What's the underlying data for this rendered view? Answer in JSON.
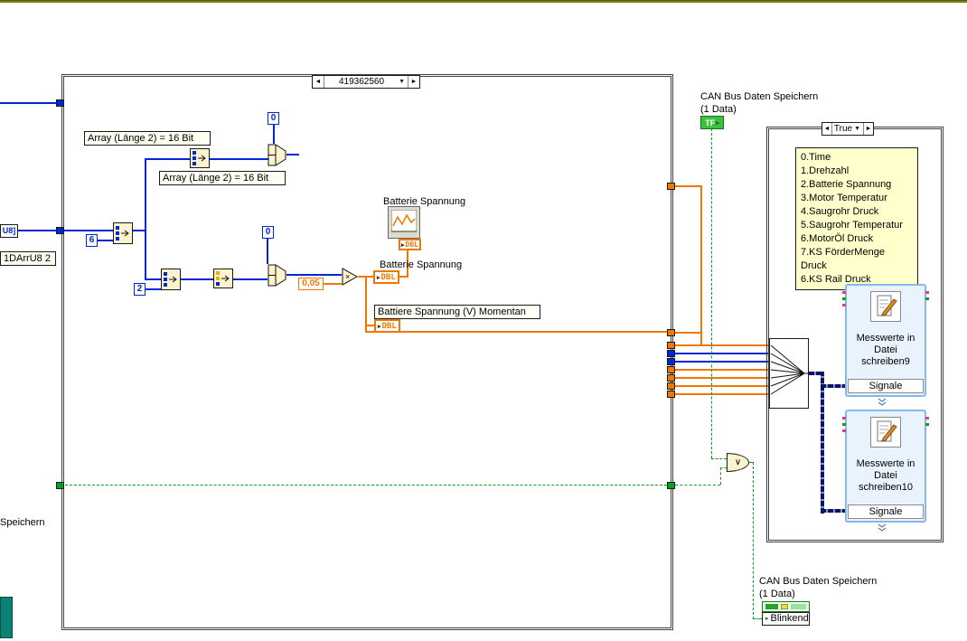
{
  "icons": {
    "arrow_left": "◄",
    "arrow_right": "►",
    "dropdown": "▼",
    "terminal_arrow": "▸",
    "or_symbol": "∨",
    "multiply_symbol": "×"
  },
  "dbl_label": "DBL",
  "header": {
    "can_label_line1": "CAN Bus Daten Speichern",
    "can_label_line2": "(1 Data)",
    "tf_label": "TF"
  },
  "left_edge": {
    "u8_constant": "U8]",
    "array_label": "1DArrU8 2",
    "speichern_label": "Speichern"
  },
  "main_case": {
    "selector": "419362560",
    "label_array16_1": "Array (Länge 2) = 16 Bit",
    "label_array16_2": "Array (Länge 2) = 16 Bit",
    "const_zero_1": "0",
    "const_zero_2": "0",
    "const_six": "6",
    "const_two": "2",
    "const_factor": "0,05",
    "label_chart": "Batterie Spannung",
    "label_dbl": "Batterie Spannung",
    "label_momentan": "Battiere Spannung (V) Momentan"
  },
  "right_case": {
    "selector": "True",
    "signals": [
      "0.Time",
      "1.Drehzahl",
      "2.Batterie Spannung",
      "3.Motor Temperatur",
      "4.Saugrohr Druck",
      "5.Saugrohr Temperatur",
      "6.MotorÖl Druck",
      "7.KS FörderMenge Druck",
      "6.KS Rail Druck"
    ],
    "vi1_caption": "Messwerte in\nDatei\nschreiben9",
    "vi1_signale": "Signale",
    "vi2_caption": "Messwerte in\nDatei\nschreiben10",
    "vi2_signale": "Signale"
  },
  "bottom": {
    "can_label_line1": "CAN Bus Daten Speichern",
    "can_label_line2": "(1 Data)",
    "property_label": "Blinkend"
  }
}
